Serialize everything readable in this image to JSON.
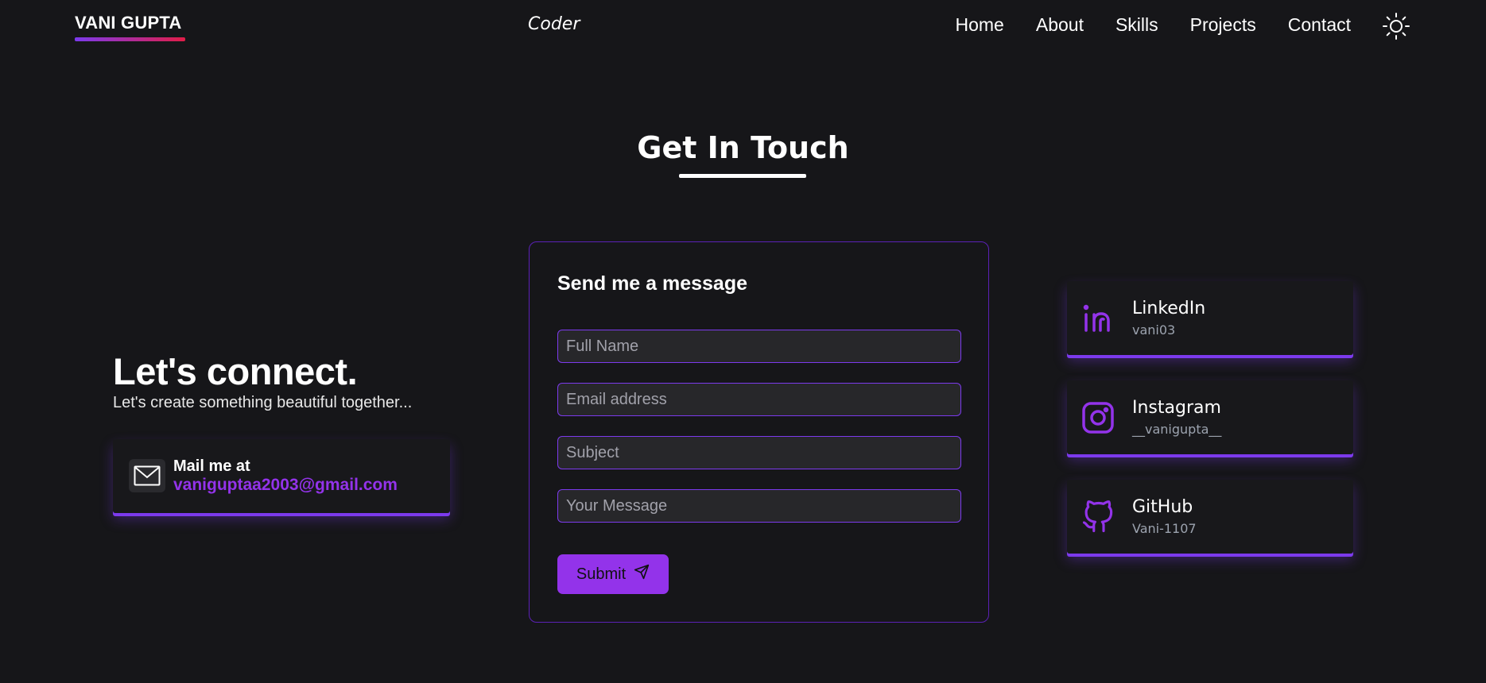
{
  "nav": {
    "brand": "VANI GUPTA",
    "role": "Coder",
    "links": [
      "Home",
      "About",
      "Skills",
      "Projects",
      "Contact"
    ],
    "theme_icon": "sun-icon"
  },
  "section": {
    "title": "Get In Touch"
  },
  "left": {
    "title": "Let's connect.",
    "subtitle": "Let's create something beautiful together...",
    "mail_label": "Mail me at",
    "mail_address": "vaniguptaa2003@gmail.com",
    "mail_icon": "mail-icon"
  },
  "form": {
    "title": "Send me a message",
    "name_placeholder": "Full Name",
    "email_placeholder": "Email address",
    "subject_placeholder": "Subject",
    "message_placeholder": "Your Message",
    "submit_label": "Submit",
    "submit_icon": "send-icon"
  },
  "social": [
    {
      "name": "LinkedIn",
      "handle": "vani03",
      "icon": "linkedin-icon"
    },
    {
      "name": "Instagram",
      "handle": "__vanigupta__",
      "icon": "instagram-icon"
    },
    {
      "name": "GitHub",
      "handle": "Vani-1107",
      "icon": "github-icon"
    }
  ],
  "colors": {
    "background": "#161619",
    "accent": "#9333ea",
    "border": "#7c3aed"
  }
}
